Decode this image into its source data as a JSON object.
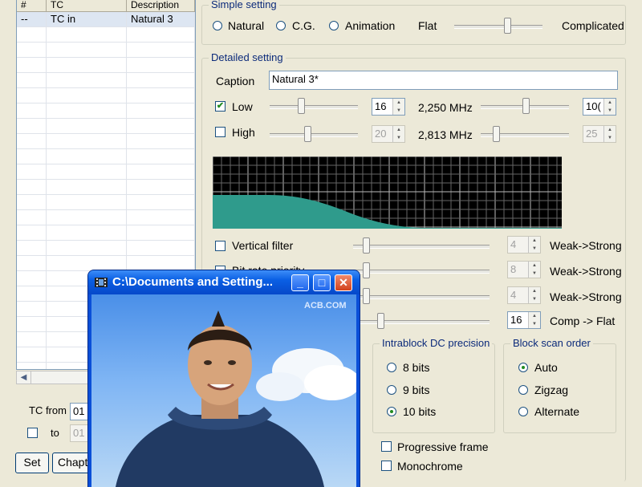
{
  "left_table": {
    "headers": [
      "#",
      "TC",
      "Description"
    ],
    "rows": [
      {
        "num": "--",
        "tc": "TC in",
        "desc": "Natural 3"
      }
    ],
    "empty_rows": 23
  },
  "bottom_left": {
    "tc_from_label": "TC from",
    "tc_from_value": "01",
    "to_label": "to",
    "to_value": "01",
    "set_button": "Set",
    "chapter_button": "Chapte"
  },
  "simple_setting": {
    "title": "Simple setting",
    "options": [
      "Natural",
      "C.G.",
      "Animation"
    ],
    "flat_label": "Flat",
    "complicated_label": "Complicated",
    "slider_value": 0.6
  },
  "detailed_setting": {
    "title": "Detailed setting",
    "caption_label": "Caption",
    "caption_value": "Natural 3*",
    "low": {
      "label": "Low",
      "checked": true,
      "value": "16",
      "freq": "2,250 MHz",
      "value2": "10("
    },
    "high": {
      "label": "High",
      "checked": false,
      "value": "20",
      "freq": "2,813 MHz",
      "value2": "25"
    }
  },
  "filters": [
    {
      "label": "Vertical filter",
      "value": "4",
      "right_label": "Weak->Strong"
    },
    {
      "label": "Bit rate priority",
      "value": "8",
      "right_label": "Weak->Strong"
    },
    {
      "label": "",
      "value": "4",
      "right_label": "Weak->Strong"
    },
    {
      "label": "",
      "value": "16",
      "right_label": "Comp -> Flat"
    }
  ],
  "intrablock": {
    "title": "Intrablock DC precision",
    "options": [
      "8 bits",
      "9 bits",
      "10 bits"
    ],
    "selected": 2
  },
  "block_scan": {
    "title": "Block scan order",
    "options": [
      "Auto",
      "Zigzag",
      "Alternate"
    ],
    "selected": 0
  },
  "checkboxes": {
    "progressive": "Progressive frame",
    "monochrome": "Monochrome"
  },
  "popup": {
    "title": "C:\\Documents and Setting...",
    "watermark": "ACB.COM",
    "minimize": "_",
    "maximize": "□",
    "close": "✕"
  },
  "colors": {
    "curve_fill": "#2f9b8c",
    "xp_blue": "#0a5fe4",
    "close_red": "#e0502b"
  }
}
